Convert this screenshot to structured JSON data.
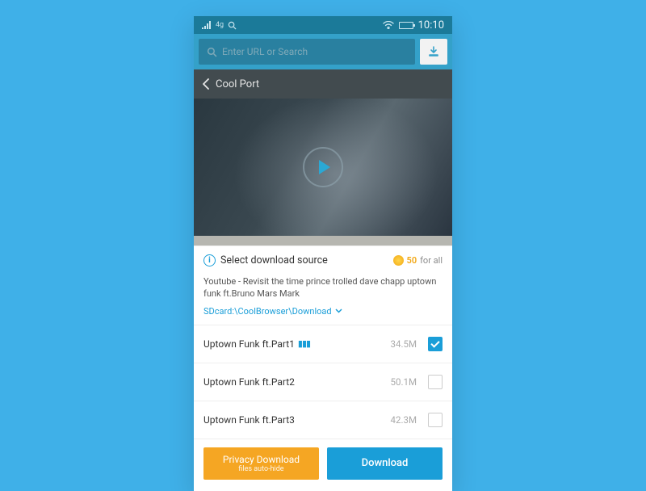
{
  "statusbar": {
    "network": "4g",
    "time": "10:10"
  },
  "urlbar": {
    "placeholder": "Enter URL or Search"
  },
  "nav": {
    "back_label": "Cool Port"
  },
  "panel": {
    "title": "Select download source",
    "coins": "50",
    "coins_suffix": "for all",
    "video_title": "Youtube - Revisit the time prince trolled dave chapp uptown funk ft.Bruno Mars Mark",
    "save_path": "SDcard:\\CoolBrowser\\Download"
  },
  "items": [
    {
      "name": "Uptown Funk ft.Part1",
      "size": "34.5M",
      "checked": true,
      "playing": true
    },
    {
      "name": "Uptown Funk ft.Part2",
      "size": "50.1M",
      "checked": false,
      "playing": false
    },
    {
      "name": "Uptown Funk ft.Part3",
      "size": "42.3M",
      "checked": false,
      "playing": false
    }
  ],
  "buttons": {
    "privacy_main": "Privacy Download",
    "privacy_sub": "files auto-hide",
    "download": "Download"
  }
}
